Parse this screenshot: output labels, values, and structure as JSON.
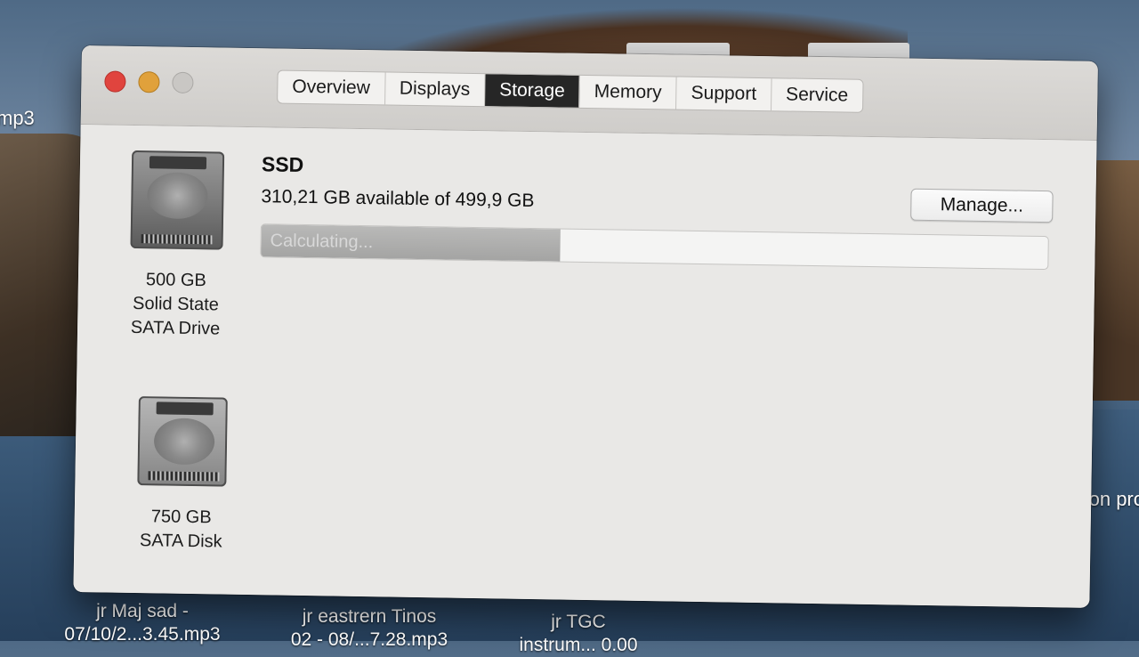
{
  "desktop": {
    "left_label": "mp3",
    "files": [
      {
        "line1": "jr Maj sad -",
        "line2": "07/10/2...3.45.mp3"
      },
      {
        "line1": "jr eastrern Tinos",
        "line2": "02 - 08/...7.28.mp3"
      },
      {
        "line1": "jr TGC",
        "line2": "instrum... 0.00"
      }
    ],
    "right_label": "tion pro"
  },
  "window": {
    "tabs": [
      {
        "label": "Overview",
        "active": false
      },
      {
        "label": "Displays",
        "active": false
      },
      {
        "label": "Storage",
        "active": true
      },
      {
        "label": "Memory",
        "active": false
      },
      {
        "label": "Support",
        "active": false
      },
      {
        "label": "Service",
        "active": false
      }
    ],
    "drives": [
      {
        "icon": "ssd-drive-icon",
        "line1": "500 GB",
        "line2": "Solid State",
        "line3": "SATA Drive"
      },
      {
        "icon": "hard-disk-icon",
        "line1": "750 GB",
        "line2": "SATA Disk",
        "line3": ""
      }
    ],
    "volume": {
      "name": "SSD",
      "availability": "310,21 GB available of 499,9 GB",
      "manage_label": "Manage...",
      "status": "Calculating...",
      "used_fraction": 0.38
    }
  },
  "colors": {
    "close": "#e0443e",
    "minimize": "#e0a13b",
    "active_tab": "#262626"
  }
}
